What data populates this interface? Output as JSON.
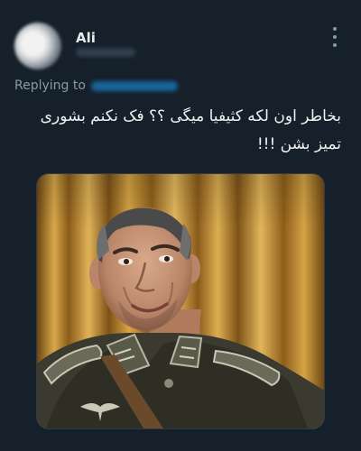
{
  "tweet": {
    "author": {
      "display_name": "Ali",
      "avatar_icon": "avatar-icon",
      "handle_blurred": true
    },
    "replying_to": {
      "label": "Replying to",
      "recipient_blurred": true
    },
    "text": "بخاطر اون لکه کثیفیا میگی ؟؟ فک نکنم بشوری تمیز بشن !!!",
    "media": {
      "icon": "photo-icon"
    },
    "more_icon": "more-options-icon"
  },
  "colors": {
    "background": "#15202b",
    "primary_text": "#e7e9ea",
    "secondary_text": "#8b98a5",
    "accent": "#1d9bf0"
  }
}
